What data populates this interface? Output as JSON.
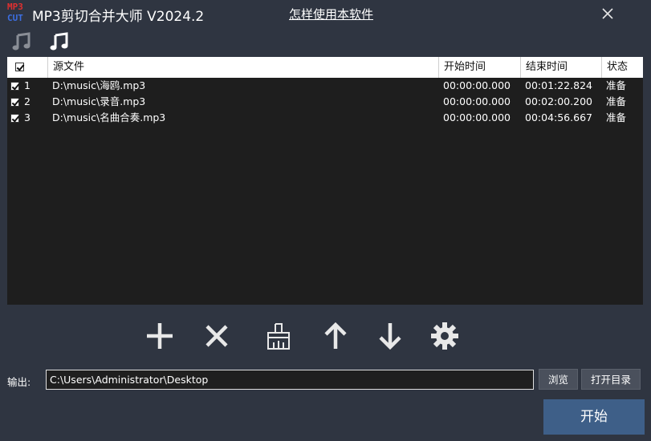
{
  "app": {
    "logo_line1": "MP3",
    "logo_line2": "CUT",
    "title": "MP3剪切合并大师 V2024.2",
    "help_link": "怎样使用本软件"
  },
  "toolbar": {
    "cut_mode_icon": "music-note-dim-icon",
    "merge_mode_icon": "music-note-icon"
  },
  "table": {
    "columns": [
      "源文件",
      "开始时间",
      "结束时间",
      "状态"
    ],
    "rows": [
      {
        "index": "1",
        "checked": true,
        "source": "D:\\music\\海鸥.mp3",
        "start": "00:00:00.000",
        "end": "00:01:22.824",
        "status": "准备"
      },
      {
        "index": "2",
        "checked": true,
        "source": "D:\\music\\录音.mp3",
        "start": "00:00:00.000",
        "end": "00:02:00.200",
        "status": "准备"
      },
      {
        "index": "3",
        "checked": true,
        "source": "D:\\music\\名曲合奏.mp3",
        "start": "00:00:00.000",
        "end": "00:04:56.667",
        "status": "准备"
      }
    ]
  },
  "actions": [
    "plus-icon",
    "x-icon",
    "broom-icon",
    "arrow-up-icon",
    "arrow-down-icon",
    "gear-icon"
  ],
  "output": {
    "label": "输出:",
    "path": "C:\\Users\\Administrator\\Desktop",
    "browse": "浏览",
    "open_dir": "打开目录"
  },
  "start_button": "开始",
  "colors": {
    "background": "#2f3541",
    "list_background": "#1e1e1e",
    "start_button": "#3e5f88",
    "logo_red": "#e03030",
    "logo_blue": "#3c6ee0"
  }
}
